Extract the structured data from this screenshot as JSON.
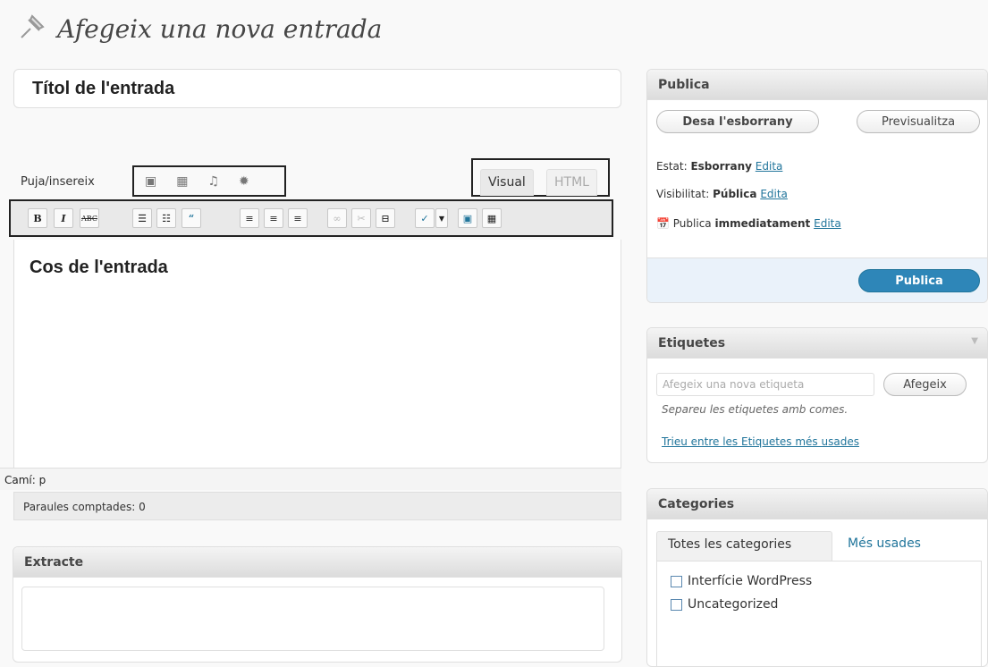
{
  "page": {
    "title": "Afegeix una nova entrada"
  },
  "editor": {
    "title_value": "Títol de l'entrada",
    "upload_label": "Puja/insereix",
    "tabs": {
      "visual": "Visual",
      "html": "HTML"
    },
    "body": "Cos de l'entrada",
    "path": "Camí: p",
    "word_count": "Paraules comptades: 0"
  },
  "excerpt": {
    "title": "Extracte"
  },
  "publish": {
    "title": "Publica",
    "save_draft": "Desa l'esborrany",
    "preview": "Previsualitza",
    "status_label": "Estat: ",
    "status_value": "Esborrany",
    "visibility_label": "Visibilitat: ",
    "visibility_value": "Pública",
    "schedule_label": "Publica ",
    "schedule_value": "immediatament",
    "edit": "Edita",
    "publish_button": "Publica"
  },
  "tags": {
    "title": "Etiquetes",
    "placeholder": "Afegeix una nova etiqueta",
    "add_button": "Afegeix",
    "hint": "Separeu les etiquetes amb comes.",
    "popular_link": "Trieu entre les Etiquetes més usades"
  },
  "categories": {
    "title": "Categories",
    "tab_all": "Totes les categories",
    "tab_popular": "Més usades",
    "items": [
      "Interfície WordPress",
      "Uncategorized"
    ]
  },
  "colors": {
    "accent": "#21759b",
    "publish_bg": "#2e86b8"
  }
}
